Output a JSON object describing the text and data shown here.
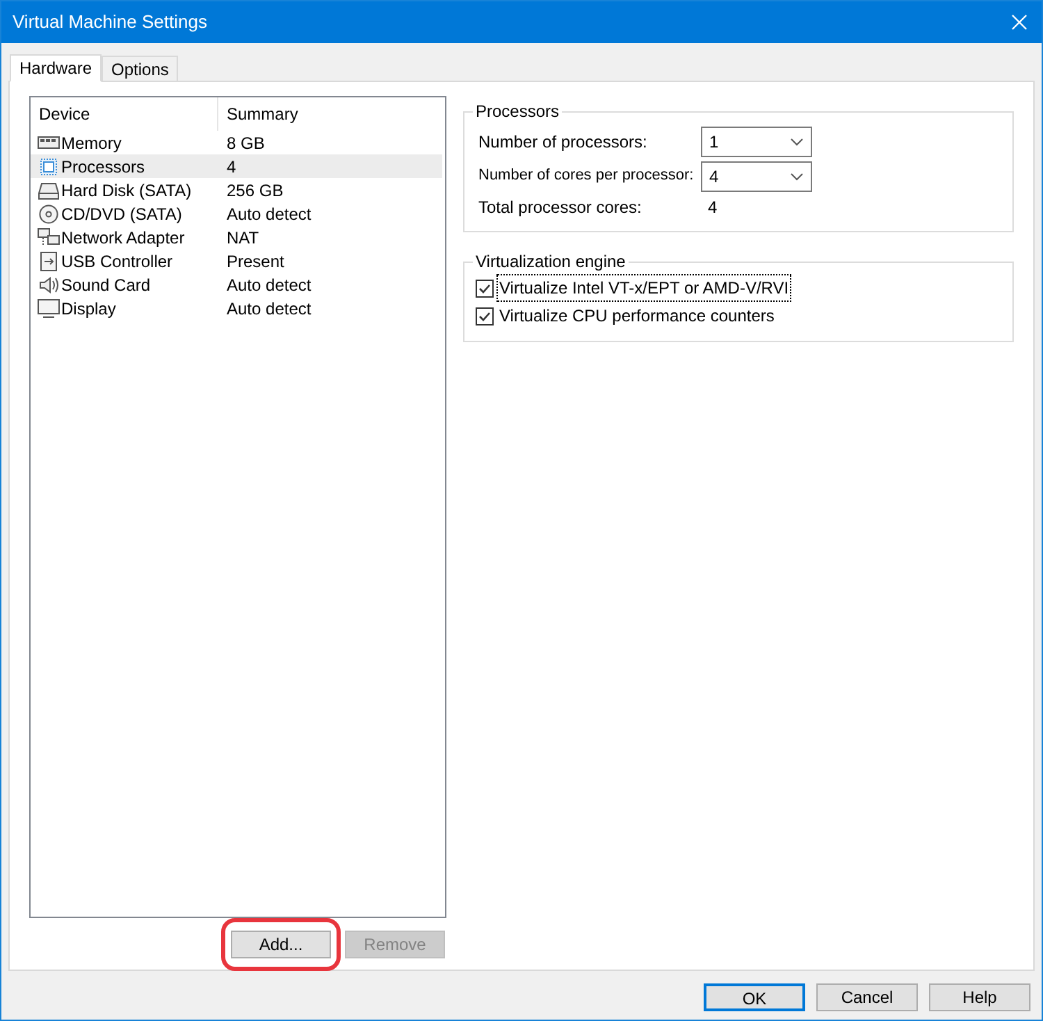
{
  "window": {
    "title": "Virtual Machine Settings"
  },
  "tabs": [
    {
      "label": "Hardware",
      "selected": true
    },
    {
      "label": "Options",
      "selected": false
    }
  ],
  "device_list": {
    "columns": [
      "Device",
      "Summary"
    ],
    "rows": [
      {
        "kind": "memory",
        "device": "Memory",
        "summary": "8 GB",
        "selected": false
      },
      {
        "kind": "processor",
        "device": "Processors",
        "summary": "4",
        "selected": true
      },
      {
        "kind": "disk",
        "device": "Hard Disk (SATA)",
        "summary": "256 GB",
        "selected": false
      },
      {
        "kind": "cd",
        "device": "CD/DVD (SATA)",
        "summary": "Auto detect",
        "selected": false
      },
      {
        "kind": "network",
        "device": "Network Adapter",
        "summary": "NAT",
        "selected": false
      },
      {
        "kind": "usb",
        "device": "USB Controller",
        "summary": "Present",
        "selected": false
      },
      {
        "kind": "sound",
        "device": "Sound Card",
        "summary": "Auto detect",
        "selected": false
      },
      {
        "kind": "display",
        "device": "Display",
        "summary": "Auto detect",
        "selected": false
      }
    ]
  },
  "list_buttons": [
    {
      "label": "Add...",
      "disabled": false,
      "highlighted": true
    },
    {
      "label": "Remove",
      "disabled": true,
      "highlighted": false
    }
  ],
  "processors": {
    "title": "Processors",
    "number_of_processors": {
      "label": "Number of processors:",
      "value": "1"
    },
    "cores_per_processor": {
      "label": "Number of cores per processor:",
      "value": "4"
    },
    "total": {
      "label": "Total processor cores:",
      "value": "4"
    }
  },
  "virtualization": {
    "title": "Virtualization engine",
    "options": [
      {
        "label": "Virtualize Intel VT-x/EPT or AMD-V/RVI",
        "checked": true,
        "focused": true
      },
      {
        "label": "Virtualize CPU performance counters",
        "checked": true,
        "focused": false
      }
    ]
  },
  "dialog_buttons": [
    {
      "label": "OK",
      "default": true
    },
    {
      "label": "Cancel",
      "default": false
    },
    {
      "label": "Help",
      "default": false
    }
  ]
}
